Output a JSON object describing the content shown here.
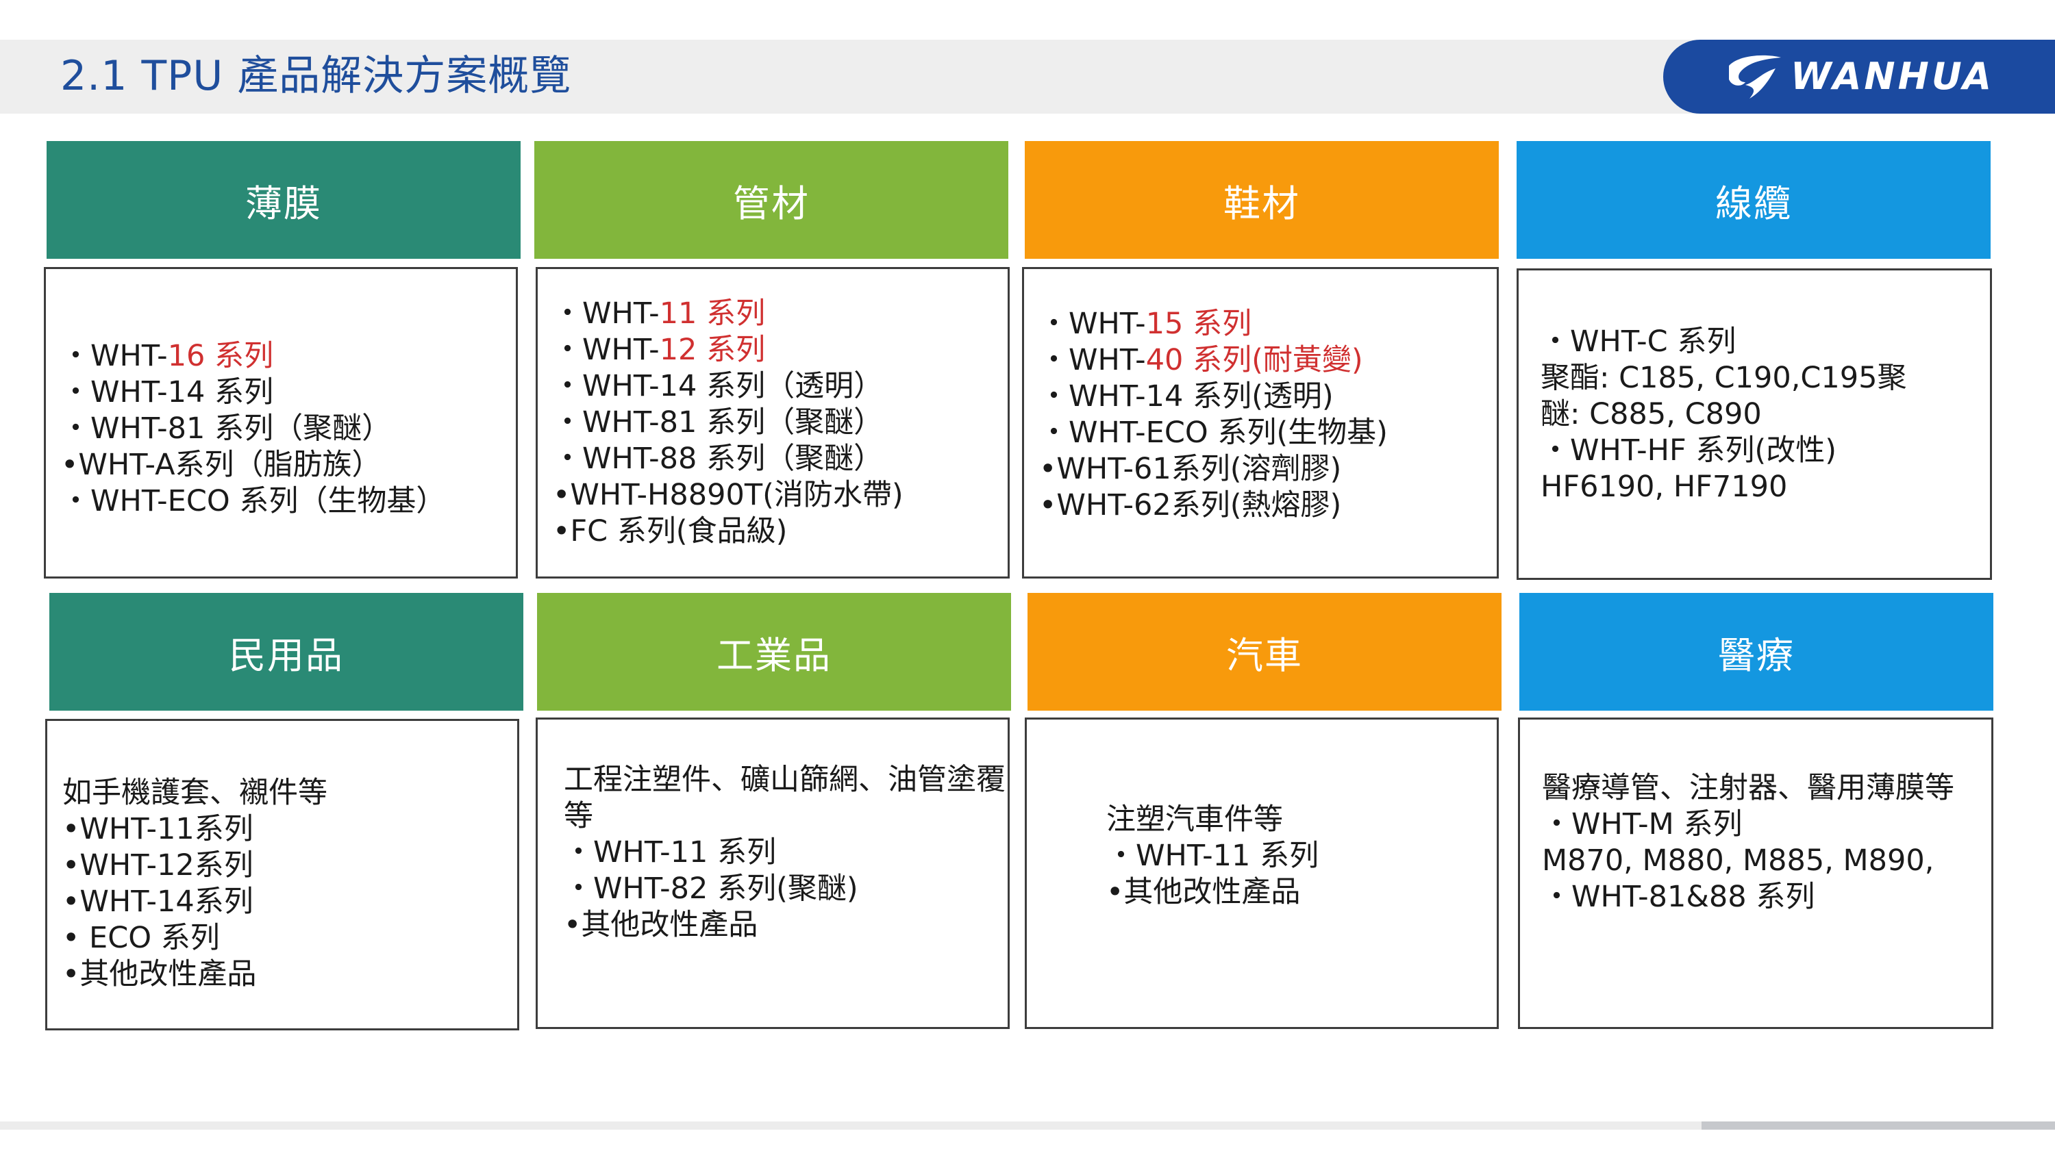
{
  "header": {
    "title": "2.1 TPU 產品解決方案概覽",
    "logo_text": "WANHUA",
    "logo_icon": "wanhua-mark-icon"
  },
  "colors": {
    "teal": "#2a8a75",
    "green": "#82b63c",
    "orange": "#f89a0c",
    "blue": "#1497e0",
    "title_blue": "#1f4e9c",
    "logo_blue": "#1b4aa0",
    "highlight_red": "#d03030"
  },
  "categories": {
    "film": {
      "title": "薄膜",
      "lines": [
        {
          "pre": "・WHT-",
          "red": "16 系列",
          "post": ""
        },
        {
          "pre": "・WHT-14 系列",
          "red": "",
          "post": ""
        },
        {
          "pre": "・WHT-81 系列（聚醚）",
          "red": "",
          "post": ""
        },
        {
          "pre": "•WHT-A系列（脂肪族）",
          "red": "",
          "post": ""
        },
        {
          "pre": "・WHT-ECO 系列（生物基）",
          "red": "",
          "post": ""
        }
      ]
    },
    "tube": {
      "title": "管材",
      "lines": [
        {
          "pre": "・WHT-",
          "red": "11 系列",
          "post": ""
        },
        {
          "pre": "・WHT-",
          "red": "12 系列",
          "post": ""
        },
        {
          "pre": "・WHT-14 系列（透明）",
          "red": "",
          "post": ""
        },
        {
          "pre": "・WHT-81 系列（聚醚）",
          "red": "",
          "post": ""
        },
        {
          "pre": "・WHT-88 系列（聚醚）",
          "red": "",
          "post": ""
        },
        {
          "pre": "•WHT-H8890T(消防水帶)",
          "red": "",
          "post": ""
        },
        {
          "pre": "•FC 系列(食品級)",
          "red": "",
          "post": ""
        }
      ]
    },
    "shoe": {
      "title": "鞋材",
      "lines": [
        {
          "pre": "・WHT-",
          "red": "15 系列",
          "post": ""
        },
        {
          "pre": "・WHT-",
          "red": "40 系列(耐黃變)",
          "post": ""
        },
        {
          "pre": "・WHT-14 系列(透明)",
          "red": "",
          "post": ""
        },
        {
          "pre": "・WHT-ECO 系列(生物基)",
          "red": "",
          "post": ""
        },
        {
          "pre": "•WHT-61系列(溶劑膠)",
          "red": "",
          "post": ""
        },
        {
          "pre": "•WHT-62系列(熱熔膠)",
          "red": "",
          "post": ""
        }
      ]
    },
    "cable": {
      "title": "線纜",
      "lines": [
        {
          "pre": "・WHT-C 系列",
          "red": "",
          "post": ""
        },
        {
          "pre": "聚酯: C185, C190,C195聚",
          "red": "",
          "post": ""
        },
        {
          "pre": "醚: C885, C890",
          "red": "",
          "post": ""
        },
        {
          "pre": "・WHT-HF 系列(改性)",
          "red": "",
          "post": ""
        },
        {
          "pre": "HF6190, HF7190",
          "red": "",
          "post": ""
        }
      ]
    },
    "consumer": {
      "title": "民用品",
      "lines": [
        {
          "pre": "如手機護套、襯件等",
          "red": "",
          "post": ""
        },
        {
          "pre": "•WHT-11系列",
          "red": "",
          "post": ""
        },
        {
          "pre": "•WHT-12系列",
          "red": "",
          "post": ""
        },
        {
          "pre": "•WHT-14系列",
          "red": "",
          "post": ""
        },
        {
          "pre": "• ECO 系列",
          "red": "",
          "post": ""
        },
        {
          "pre": "•其他改性產品",
          "red": "",
          "post": ""
        }
      ]
    },
    "industrial": {
      "title": "工業品",
      "lines": [
        {
          "pre": "工程注塑件、礦山篩網、油管塗覆",
          "red": "",
          "post": ""
        },
        {
          "pre": "等",
          "red": "",
          "post": ""
        },
        {
          "pre": "・WHT-11 系列",
          "red": "",
          "post": ""
        },
        {
          "pre": "・WHT-82 系列(聚醚)",
          "red": "",
          "post": ""
        },
        {
          "pre": "•其他改性產品",
          "red": "",
          "post": ""
        }
      ]
    },
    "auto": {
      "title": "汽車",
      "lines": [
        {
          "pre": "注塑汽車件等",
          "red": "",
          "post": ""
        },
        {
          "pre": "・WHT-11 系列",
          "red": "",
          "post": ""
        },
        {
          "pre": "•其他改性產品",
          "red": "",
          "post": ""
        }
      ]
    },
    "medical": {
      "title": "醫療",
      "lines": [
        {
          "pre": "醫療導管、注射器、醫用薄膜等",
          "red": "",
          "post": ""
        },
        {
          "pre": "・WHT-M 系列",
          "red": "",
          "post": ""
        },
        {
          "pre": "M870, M880, M885, M890,",
          "red": "",
          "post": ""
        },
        {
          "pre": "・WHT-81&88 系列",
          "red": "",
          "post": ""
        }
      ]
    }
  }
}
